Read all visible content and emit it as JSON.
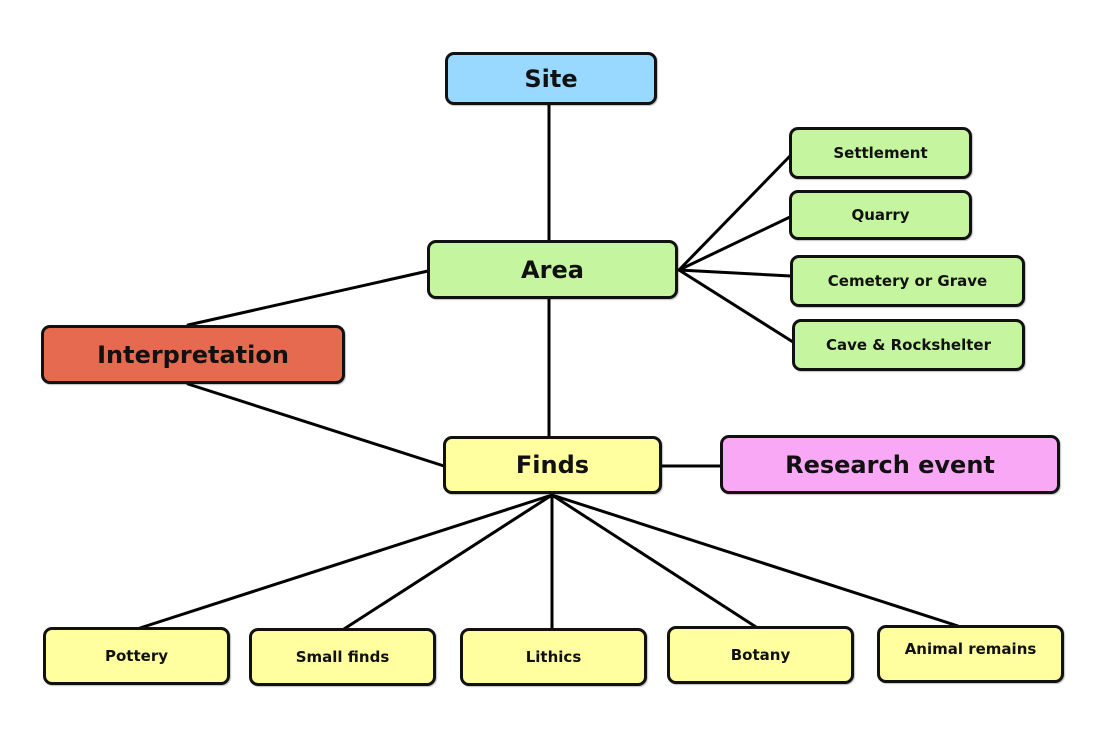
{
  "diagram": {
    "nodes": {
      "site": {
        "label": "Site",
        "color": "#99D9FF"
      },
      "area": {
        "label": "Area",
        "color": "#C6F5A0"
      },
      "settlement": {
        "label": "Settlement",
        "color": "#C6F5A0"
      },
      "quarry": {
        "label": "Quarry",
        "color": "#C6F5A0"
      },
      "cemetery": {
        "label": "Cemetery or Grave",
        "color": "#C6F5A0"
      },
      "cave": {
        "label": "Cave & Rockshelter",
        "color": "#C6F5A0"
      },
      "interpretation": {
        "label": "Interpretation",
        "color": "#E56A50"
      },
      "finds": {
        "label": "Finds",
        "color": "#FFFFA0"
      },
      "research_event": {
        "label": "Research event",
        "color": "#F8A8F4"
      },
      "pottery": {
        "label": "Pottery",
        "color": "#FFFFA0"
      },
      "small_finds": {
        "label": "Small finds",
        "color": "#FFFFA0"
      },
      "lithics": {
        "label": "Lithics",
        "color": "#FFFFA0"
      },
      "botany": {
        "label": "Botany",
        "color": "#FFFFA0"
      },
      "animal_remains": {
        "label": "Animal remains",
        "color": "#FFFFA0"
      }
    },
    "edges": [
      [
        "site",
        "area"
      ],
      [
        "area",
        "settlement"
      ],
      [
        "area",
        "quarry"
      ],
      [
        "area",
        "cemetery"
      ],
      [
        "area",
        "cave"
      ],
      [
        "area",
        "interpretation"
      ],
      [
        "area",
        "finds"
      ],
      [
        "interpretation",
        "finds"
      ],
      [
        "finds",
        "research_event"
      ],
      [
        "finds",
        "pottery"
      ],
      [
        "finds",
        "small_finds"
      ],
      [
        "finds",
        "lithics"
      ],
      [
        "finds",
        "botany"
      ],
      [
        "finds",
        "animal_remains"
      ]
    ]
  }
}
